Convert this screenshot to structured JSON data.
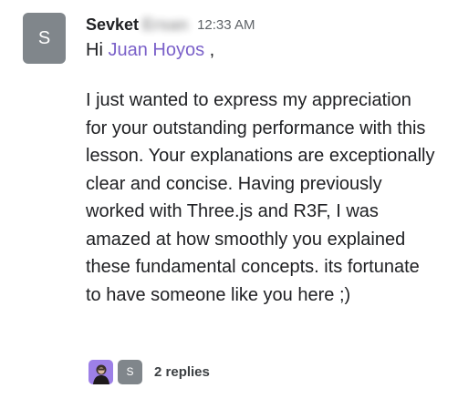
{
  "message": {
    "avatar_initial": "S",
    "sender_first_name": "Sevket",
    "sender_last_name": "Ersan",
    "time": "12:33 AM",
    "greeting_prefix": "Hi",
    "mention": "Juan Hoyos",
    "greeting_suffix": ",",
    "body": "I just wanted to express my appreciation for your outstanding performance with this lesson. Your explanations are exceptionally clear and concise. Having previously worked with Three.js and R3F, I was amazed at how smoothly you explained these fundamental concepts. its fortunate to have someone like you here ;)"
  },
  "thread": {
    "participant_initial": "S",
    "reply_count_label": "2 replies"
  },
  "colors": {
    "avatar_gray": "#80868b",
    "mention_purple": "#7b61c9",
    "text": "#202124"
  }
}
